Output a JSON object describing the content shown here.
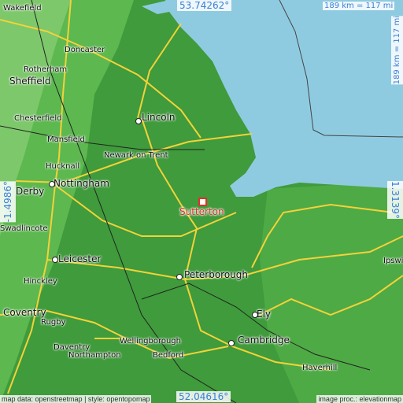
{
  "map": {
    "coords": {
      "top": "53.74262°",
      "bottom": "52.04616°",
      "left": "-1.4986°",
      "right": "1.3139°"
    },
    "scale_horizontal": "189 km = 117 mi",
    "scale_vertical": "189 km = 117 mi",
    "marker_label": "Sutterton",
    "attribution_left": "map data: openstreetmap | style: opentopomap",
    "attribution_right": "image proc.: elevationmap",
    "cities": [
      "Wakefield",
      "Doncaster",
      "Rotherham",
      "Sheffield",
      "Chesterfield",
      "Mansfield",
      "Hucknall",
      "Nottingham",
      "Derby",
      "Swadlincote",
      "Lincoln",
      "Newark on Trent",
      "Leicester",
      "Hinckley",
      "Coventry",
      "Rugby",
      "Daventry",
      "Northampton",
      "Wellingborough",
      "Bedford",
      "Peterborough",
      "Ely",
      "Cambridge",
      "Haverhill",
      "Ipswich"
    ]
  },
  "colors": {
    "sea": "#8fcbe0",
    "land_low": "#3f9b3b",
    "land_mid": "#5cb84f",
    "land_high": "#8fd17a",
    "roads": "#f3d23a",
    "marker": "#e0302a",
    "coord_text": "#3b7fd6"
  }
}
